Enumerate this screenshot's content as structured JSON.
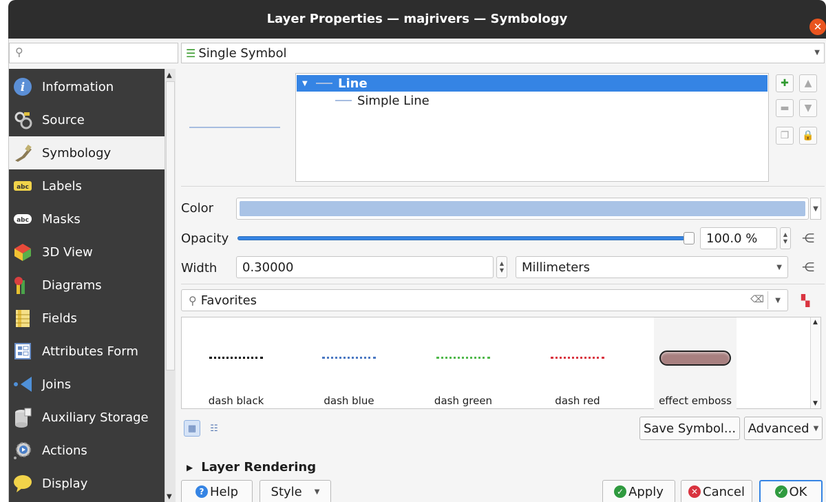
{
  "window": {
    "title": "Layer Properties — majrivers — Symbology"
  },
  "sidebar": {
    "search_placeholder": "",
    "items": [
      {
        "label": "Information",
        "icon": "info-icon"
      },
      {
        "label": "Source",
        "icon": "source-icon"
      },
      {
        "label": "Symbology",
        "icon": "symbology-icon",
        "active": true
      },
      {
        "label": "Labels",
        "icon": "labels-icon"
      },
      {
        "label": "Masks",
        "icon": "masks-icon"
      },
      {
        "label": "3D View",
        "icon": "3d-view-icon"
      },
      {
        "label": "Diagrams",
        "icon": "diagrams-icon"
      },
      {
        "label": "Fields",
        "icon": "fields-icon"
      },
      {
        "label": "Attributes Form",
        "icon": "attributes-form-icon"
      },
      {
        "label": "Joins",
        "icon": "joins-icon"
      },
      {
        "label": "Auxiliary Storage",
        "icon": "auxiliary-storage-icon"
      },
      {
        "label": "Actions",
        "icon": "actions-icon"
      },
      {
        "label": "Display",
        "icon": "display-icon"
      }
    ]
  },
  "renderer": {
    "selected": "Single Symbol"
  },
  "symbol_tree": {
    "rows": [
      {
        "label": "Line",
        "selected": true
      },
      {
        "label": "Simple Line",
        "selected": false
      }
    ]
  },
  "properties": {
    "color_label": "Color",
    "color_value": "#a9c3e6",
    "opacity_label": "Opacity",
    "opacity_value": "100.0 %",
    "opacity_fraction": 1.0,
    "width_label": "Width",
    "width_value": "0.30000",
    "unit_value": "Millimeters"
  },
  "library": {
    "search_value": "Favorites",
    "symbols": [
      {
        "name": "dash  black",
        "color": "#000000"
      },
      {
        "name": "dash blue",
        "color": "#4a78c2"
      },
      {
        "name": "dash green",
        "color": "#4fb84a"
      },
      {
        "name": "dash red",
        "color": "#d9333f"
      },
      {
        "name": "effect emboss",
        "color": "#a88080"
      }
    ],
    "save_button": "Save Symbol...",
    "advanced_button": "Advanced"
  },
  "layer_rendering": {
    "label": "Layer Rendering"
  },
  "footer": {
    "help": "Help",
    "style": "Style",
    "apply": "Apply",
    "cancel": "Cancel",
    "ok": "OK"
  },
  "colors": {
    "accent": "#3584e4",
    "sidebar_bg": "#3b3b3b",
    "titlebar_bg": "#2d2d2d",
    "close": "#e9541f"
  }
}
